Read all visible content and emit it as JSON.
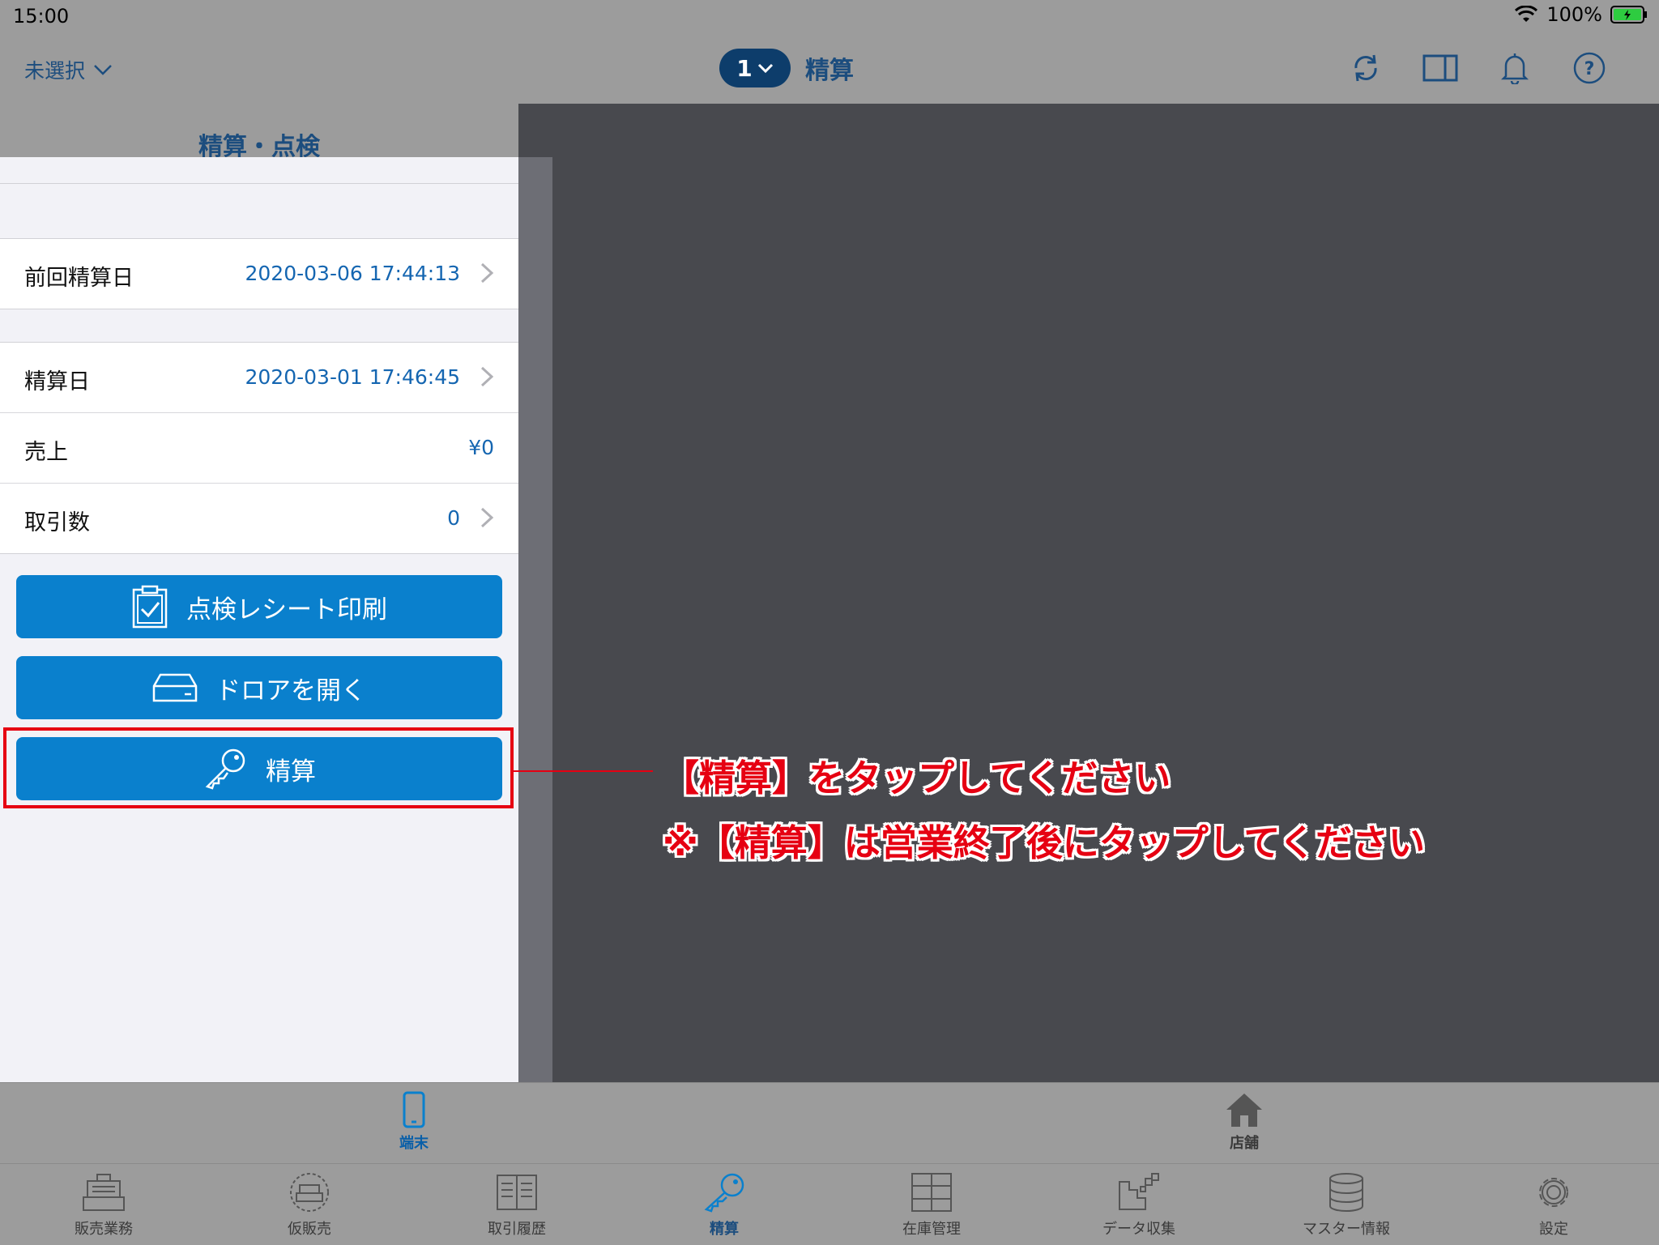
{
  "status_bar": {
    "time": "15:00",
    "battery": "100%"
  },
  "nav": {
    "store_select": "未選択",
    "register_number": "1",
    "title": "精算"
  },
  "panel": {
    "title": "精算・点検",
    "last_settlement": {
      "label": "前回精算日",
      "value": "2020-03-06 17:44:13"
    },
    "settlement_date": {
      "label": "精算日",
      "value": "2020-03-01 17:46:45"
    },
    "sales": {
      "label": "売上",
      "value": "¥0"
    },
    "transactions": {
      "label": "取引数",
      "value": "0"
    },
    "buttons": {
      "print_receipt": "点検レシート印刷",
      "open_drawer": "ドロアを開く",
      "settle": "精算"
    }
  },
  "annotation": {
    "line1": "【精算】をタップしてください",
    "line2": "※【精算】は営業終了後にタップしてください"
  },
  "segment": {
    "terminal": "端末",
    "store": "店舗"
  },
  "tabs": [
    {
      "label": "販売業務",
      "icon": "register-icon"
    },
    {
      "label": "仮販売",
      "icon": "provisional-register-icon"
    },
    {
      "label": "取引履歴",
      "icon": "history-icon"
    },
    {
      "label": "精算",
      "icon": "key-icon"
    },
    {
      "label": "在庫管理",
      "icon": "cabinet-icon"
    },
    {
      "label": "データ収集",
      "icon": "data-collection-icon"
    },
    {
      "label": "マスター情報",
      "icon": "database-icon"
    },
    {
      "label": "設定",
      "icon": "gear-icon"
    }
  ],
  "colors": {
    "accent": "#0A80CD",
    "annotation": "#E60012",
    "nav_text": "#1C4D7E"
  }
}
